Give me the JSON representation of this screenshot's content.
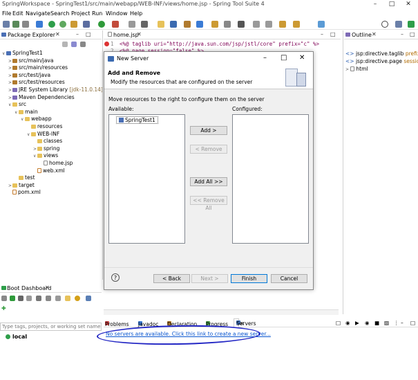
{
  "window": {
    "title": "SpringWorkspace - SpringTest1/src/main/webapp/WEB-INF/views/home.jsp - Spring Tool Suite 4",
    "minimize_icon": "minimize-icon",
    "maximize_icon": "maximize-icon",
    "close_icon": "close-icon"
  },
  "menu": [
    "File",
    "Edit",
    "Navigate",
    "Search",
    "Project",
    "Run",
    "Window",
    "Help"
  ],
  "package_explorer": {
    "title": "Package Explorer",
    "tree": [
      {
        "label": "SpringTest1",
        "indent": 0,
        "icon": "proj",
        "arrow": "v"
      },
      {
        "label": "src/main/java",
        "indent": 1,
        "icon": "pkg",
        "arrow": ">"
      },
      {
        "label": "src/main/resources",
        "indent": 1,
        "icon": "pkg",
        "arrow": ">"
      },
      {
        "label": "src/test/java",
        "indent": 1,
        "icon": "pkg",
        "arrow": ">"
      },
      {
        "label": "src/test/resources",
        "indent": 1,
        "icon": "pkg",
        "arrow": ">"
      },
      {
        "label": "JRE System Library",
        "suffix": " [jdk-11.0.14]",
        "indent": 1,
        "icon": "lib",
        "arrow": ">"
      },
      {
        "label": "Maven Dependencies",
        "indent": 1,
        "icon": "lib",
        "arrow": ">"
      },
      {
        "label": "src",
        "indent": 1,
        "icon": "folder",
        "arrow": "v"
      },
      {
        "label": "main",
        "indent": 2,
        "icon": "folder",
        "arrow": "v"
      },
      {
        "label": "webapp",
        "indent": 3,
        "icon": "folder",
        "arrow": "v"
      },
      {
        "label": "resources",
        "indent": 4,
        "icon": "folder",
        "arrow": ""
      },
      {
        "label": "WEB-INF",
        "indent": 4,
        "icon": "folder",
        "arrow": "v"
      },
      {
        "label": "classes",
        "indent": 5,
        "icon": "folder",
        "arrow": ""
      },
      {
        "label": "spring",
        "indent": 5,
        "icon": "folder",
        "arrow": ">"
      },
      {
        "label": "views",
        "indent": 5,
        "icon": "folder",
        "arrow": "v"
      },
      {
        "label": "home.jsp",
        "indent": 6,
        "icon": "file",
        "arrow": ""
      },
      {
        "label": "web.xml",
        "indent": 5,
        "icon": "xml",
        "arrow": ""
      },
      {
        "label": "test",
        "indent": 2,
        "icon": "folder",
        "arrow": ""
      },
      {
        "label": "target",
        "indent": 1,
        "icon": "folder",
        "arrow": ">"
      },
      {
        "label": "pom.xml",
        "indent": 1,
        "icon": "xml",
        "arrow": ""
      }
    ]
  },
  "editor": {
    "tab": "home.jsp",
    "lines": [
      {
        "num": "1",
        "code": "<%@ taglib uri=\"http://java.sun.com/jsp/jstl/core\" prefix=\"c\" %>"
      },
      {
        "num": "2",
        "code": "<%@ page session=\"false\" %>"
      }
    ]
  },
  "outline": {
    "title": "Outline",
    "items": [
      {
        "label": "jsp:directive.taglib",
        "suffix": " prefix=c"
      },
      {
        "label": "jsp:directive.page",
        "suffix": " session=f"
      },
      {
        "label": "html",
        "suffix": ""
      }
    ]
  },
  "dialog": {
    "title": "New Server",
    "heading": "Add and Remove",
    "subheading": "Modify the resources that are configured on the server",
    "instruction": "Move resources to the right to configure them on the server",
    "available_label": "Available:",
    "configured_label": "Configured:",
    "available_items": [
      "SpringTest1"
    ],
    "buttons": {
      "add": "Add >",
      "remove": "< Remove",
      "add_all": "Add All >>",
      "remove_all": "<< Remove All",
      "back": "< Back",
      "next": "Next >",
      "finish": "Finish",
      "cancel": "Cancel"
    },
    "help_icon": "help-icon"
  },
  "boot_dashboard": {
    "title": "Boot Dashboard",
    "filter_placeholder": "Type tags, projects, or working set names to ma",
    "items": [
      "local"
    ]
  },
  "bottom_panel": {
    "tabs": [
      "Problems",
      "Javadoc",
      "Declaration",
      "Progress",
      "Servers"
    ],
    "active_tab": "Servers",
    "link": "No servers are available. Click this link to create a new server..."
  },
  "colors": {
    "link": "#0b57d0",
    "annotation": "#2226c4",
    "accent": "#0078d7"
  }
}
